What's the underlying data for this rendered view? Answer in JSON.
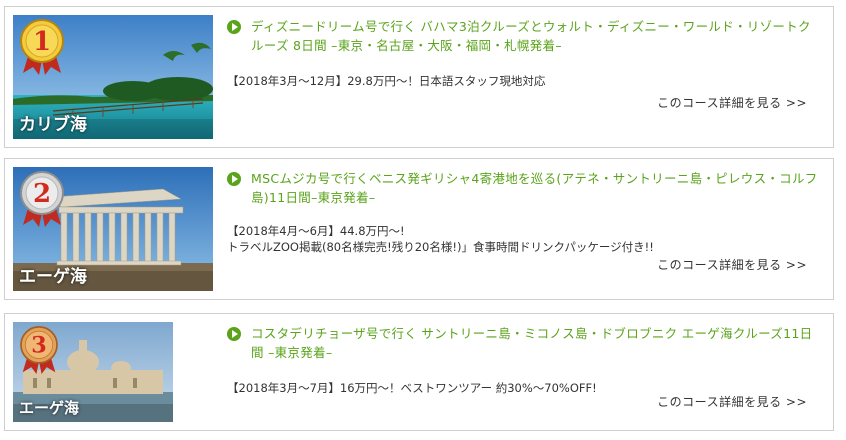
{
  "colors": {
    "accent_green": "#5aa31a",
    "border": "#cfcfcf",
    "gold": "#d9a520",
    "silver": "#b7b7b7",
    "bronze": "#c47a32"
  },
  "cruises": [
    {
      "rank": "1",
      "medal": "gold-medal-icon",
      "place": "カリブ海",
      "title": "ディズニードリーム号で行く バハマ3泊クルーズとウォルト・ディズニー・ワールド・リゾートクルーズ 8日間 –東京・名古屋・大阪・福岡・札幌発着–",
      "desc_lines": [
        "【2018年3月〜12月】29.8万円〜！日本語スタッフ現地対応"
      ],
      "more": "このコース詳細を見る >>"
    },
    {
      "rank": "2",
      "medal": "silver-medal-icon",
      "place": "エーゲ海",
      "title": "MSCムジカ号で行くベニス発ギリシャ4寄港地を巡る(アテネ・サントリーニ島・ピレウス・コルフ島)11日間–東京発着–",
      "desc_lines": [
        "【2018年4月〜6月】44.8万円〜!",
        "トラベルZOO掲載(80名様完売!残り20名様!)」食事時間ドリンクパッケージ付き!!"
      ],
      "more": "このコース詳細を見る >>"
    },
    {
      "rank": "3",
      "medal": "bronze-medal-icon",
      "place": "エーゲ海",
      "title": "コスタデリチョーザ号で行く サントリーニ島・ミコノス島・ドブロブニク エーゲ海クルーズ11日間 –東京発着–",
      "desc_lines": [
        "【2018年3月〜7月】16万円〜！ベストワンツアー 約30%〜70%OFF!"
      ],
      "more": "このコース詳細を見る >>"
    }
  ]
}
